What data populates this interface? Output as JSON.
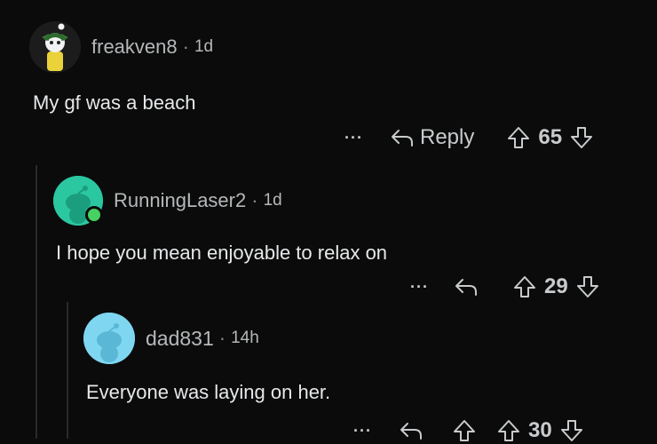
{
  "comments": [
    {
      "username": "freakven8",
      "separator": "·",
      "age": "1d",
      "text": "My gf was a beach",
      "more": "···",
      "reply_label": "Reply",
      "score": "65",
      "avatar_color": "#1c1c1c"
    },
    {
      "username": "RunningLaser2",
      "separator": "·",
      "age": "1d",
      "text": "I hope you mean enjoyable to relax on",
      "more": "···",
      "score": "29",
      "avatar_color": "#2bc7a0",
      "online_color": "#46d160"
    },
    {
      "username": "dad831",
      "separator": "·",
      "age": "14h",
      "text": "Everyone was laying on her.",
      "more": "···",
      "score": "30",
      "avatar_color": "#7fd6f0"
    }
  ]
}
